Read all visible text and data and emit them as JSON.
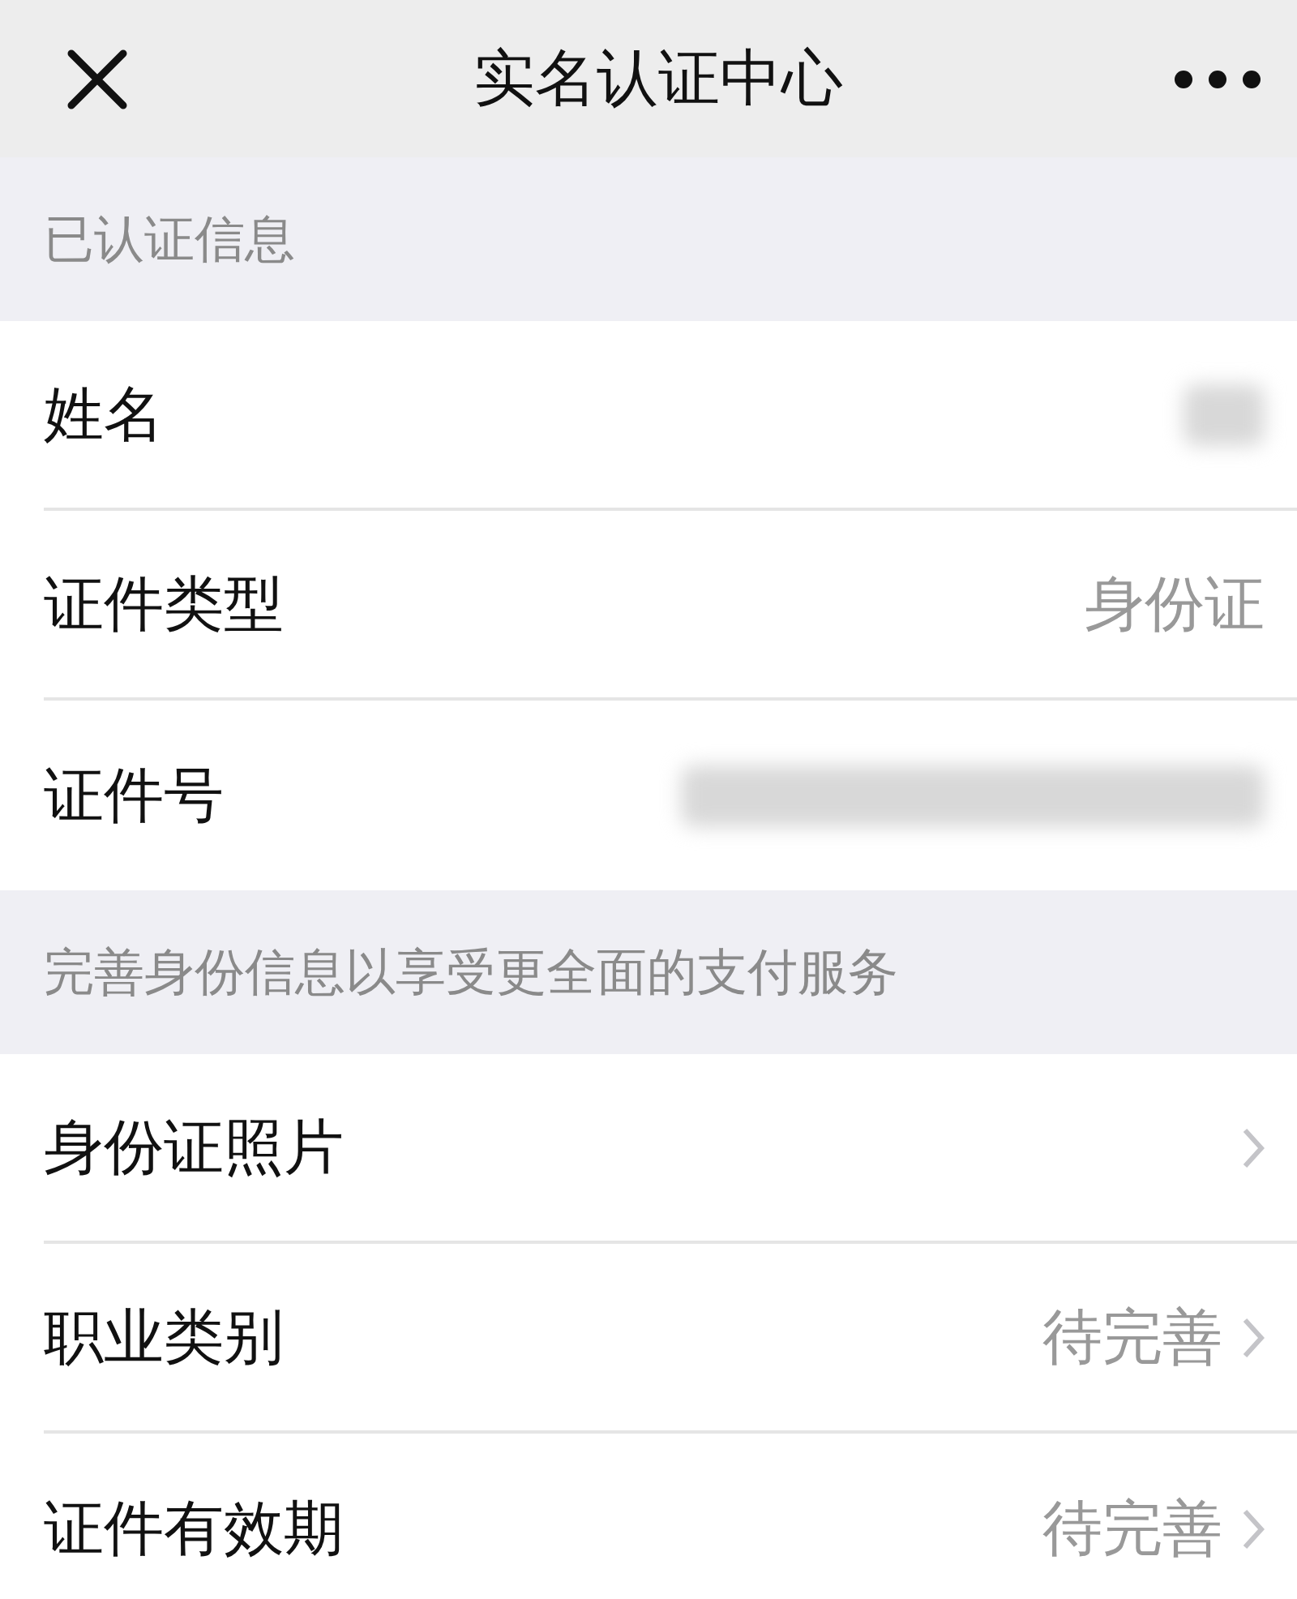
{
  "nav_bar": {
    "title": "实名认证中心"
  },
  "sections": [
    {
      "header": "已认证信息",
      "rows": [
        {
          "label": "姓名",
          "kind": "blurred_short"
        },
        {
          "label": "证件类型",
          "kind": "value",
          "value": "身份证"
        },
        {
          "label": "证件号",
          "kind": "blurred_long"
        }
      ]
    },
    {
      "header": "完善身份信息以享受更全面的支付服务",
      "rows": [
        {
          "label": "身份证照片",
          "kind": "link"
        },
        {
          "label": "职业类别",
          "kind": "link",
          "value": "待完善"
        },
        {
          "label": "证件有效期",
          "kind": "link",
          "value": "待完善"
        }
      ]
    }
  ]
}
